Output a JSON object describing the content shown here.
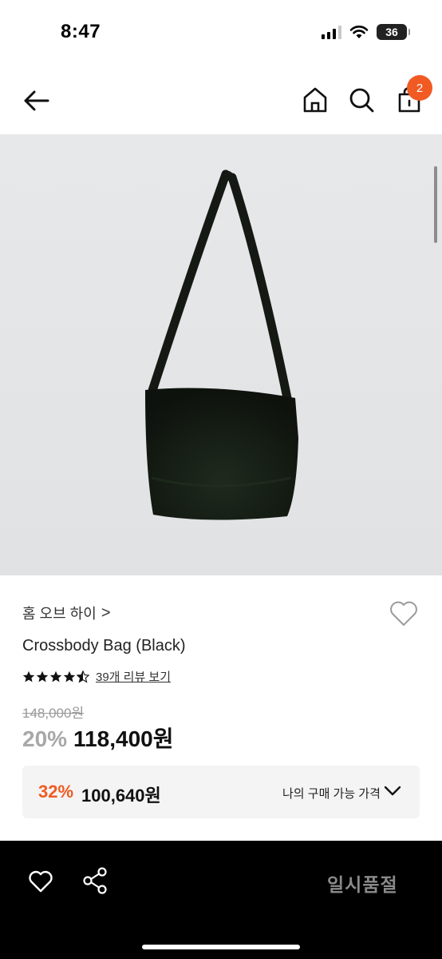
{
  "status": {
    "time": "8:47",
    "battery": "36"
  },
  "header": {
    "cart_count": "2"
  },
  "product": {
    "brand": "홈 오브 하이",
    "brand_chevron": ">",
    "name": "Crossbody Bag (Black)",
    "rating_stars": 4.5,
    "review_link": "39개 리뷰 보기",
    "original_price": "148,000원",
    "discount_rate": "20%",
    "sale_price": "118,400원"
  },
  "my_price": {
    "rate": "32%",
    "value": "100,640원",
    "label": "나의 구매 가능 가격"
  },
  "bottom": {
    "soldout": "일시품절"
  },
  "icons": [
    "back-arrow-icon",
    "home-icon",
    "search-icon",
    "shopping-bag-icon",
    "heart-icon",
    "share-icon",
    "chevron-down-icon",
    "star-icon"
  ],
  "colors": {
    "accent": "#f15a22",
    "bottom_bar": "#000000",
    "soldout_text": "#8a8a8a"
  }
}
